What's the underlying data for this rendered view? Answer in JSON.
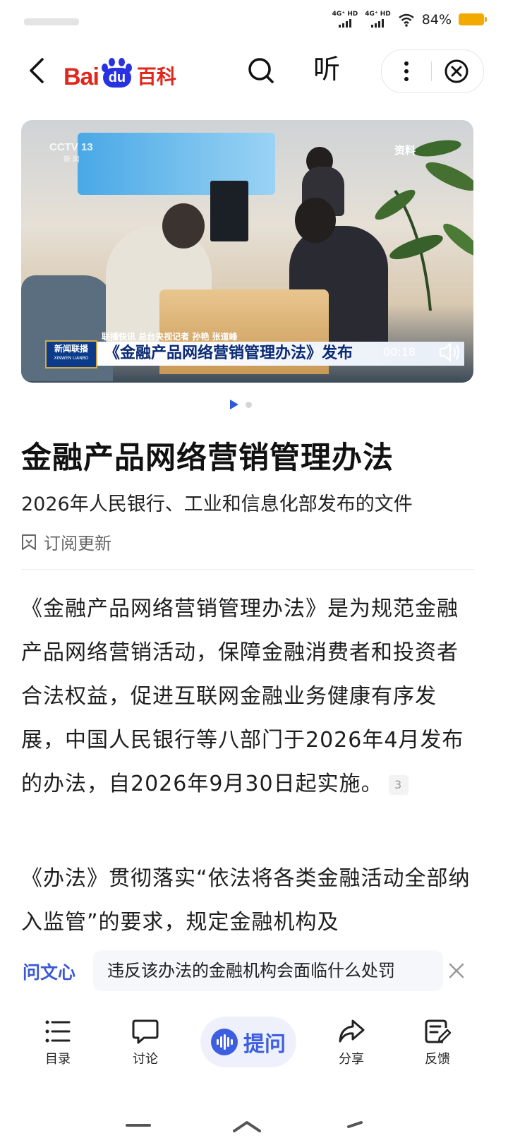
{
  "status_bar": {
    "network1": "4G⁺ HD",
    "network2": "4G⁺ HD",
    "battery": "84%",
    "battery_color": "#f2a900"
  },
  "nav": {
    "logo_text_bai": "Bai",
    "logo_text_du": "du",
    "logo_text_baike": "百科",
    "listen_label": "听",
    "icons": [
      "back-arrow-icon",
      "search-icon",
      "more-vert-icon",
      "close-circle-icon"
    ]
  },
  "hero": {
    "channel": "CCTV 13",
    "channel_sub": "新 闻",
    "tag": "资料",
    "program": "新闻联播",
    "program_en": "XINWEN LIANBO",
    "caption_small": "联播快讯   总台央视记者 孙艳 张道峰",
    "caption_main": "《金融产品网络营销管理办法》发布",
    "timer": "00:18"
  },
  "article": {
    "title": "金融产品网络营销管理办法",
    "subtitle": "2026年人民银行、工业和信息化部发布的文件",
    "subscribe_label": "订阅更新",
    "para1": "《金融产品网络营销管理办法》是为规范金融产品网络营销活动，保障金融消费者和投资者合法权益，促进互联网金融业务健康有序发展，中国人民银行等八部门于2026年4月发布的办法，自2026年9月30日起实施。",
    "para1_cite": "3",
    "para2": "《办法》贯彻落实“依法将各类金融活动全部纳入监管”的要求，规定金融机构及"
  },
  "ask_bar": {
    "brand": "问文心",
    "question": "违反该办法的金融机构会面临什么处罚"
  },
  "toolbar": {
    "catalog": "目录",
    "discuss": "讨论",
    "ask": "提问",
    "share": "分享",
    "feedback": "反馈",
    "accent": "#3d5ee0"
  }
}
